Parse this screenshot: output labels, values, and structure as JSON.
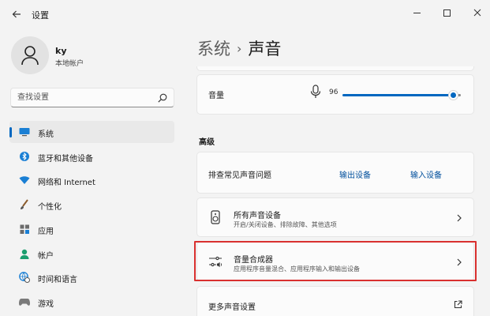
{
  "window": {
    "title": "设置"
  },
  "user": {
    "name": "ky",
    "account_type": "本地帐户"
  },
  "search": {
    "placeholder": "查找设置"
  },
  "nav": {
    "items": [
      {
        "label": "系统",
        "icon": "monitor-icon",
        "active": true
      },
      {
        "label": "蓝牙和其他设备",
        "icon": "bluetooth-icon"
      },
      {
        "label": "网络和 Internet",
        "icon": "wifi-icon"
      },
      {
        "label": "个性化",
        "icon": "brush-icon"
      },
      {
        "label": "应用",
        "icon": "apps-icon"
      },
      {
        "label": "帐户",
        "icon": "person-icon"
      },
      {
        "label": "时间和语言",
        "icon": "globe-clock-icon"
      },
      {
        "label": "游戏",
        "icon": "gamepad-icon"
      }
    ]
  },
  "breadcrumb": {
    "parent": "系统",
    "separator": "›",
    "current": "声音"
  },
  "volume": {
    "label": "音量",
    "value": "96",
    "level_percent": 96
  },
  "advanced": {
    "heading": "高级",
    "troubleshoot": {
      "label": "排查常见声音问题",
      "output_link": "输出设备",
      "input_link": "输入设备"
    },
    "all_devices": {
      "title": "所有声音设备",
      "subtitle": "开启/关闭设备、排除故障、其他选项"
    },
    "volume_mixer": {
      "title": "音量合成器",
      "subtitle": "应用程序音量混合、应用程序输入和输出设备"
    },
    "more_settings": {
      "label": "更多声音设置"
    }
  },
  "colors": {
    "accent": "#0067c0",
    "highlight_border": "#d9302f"
  }
}
